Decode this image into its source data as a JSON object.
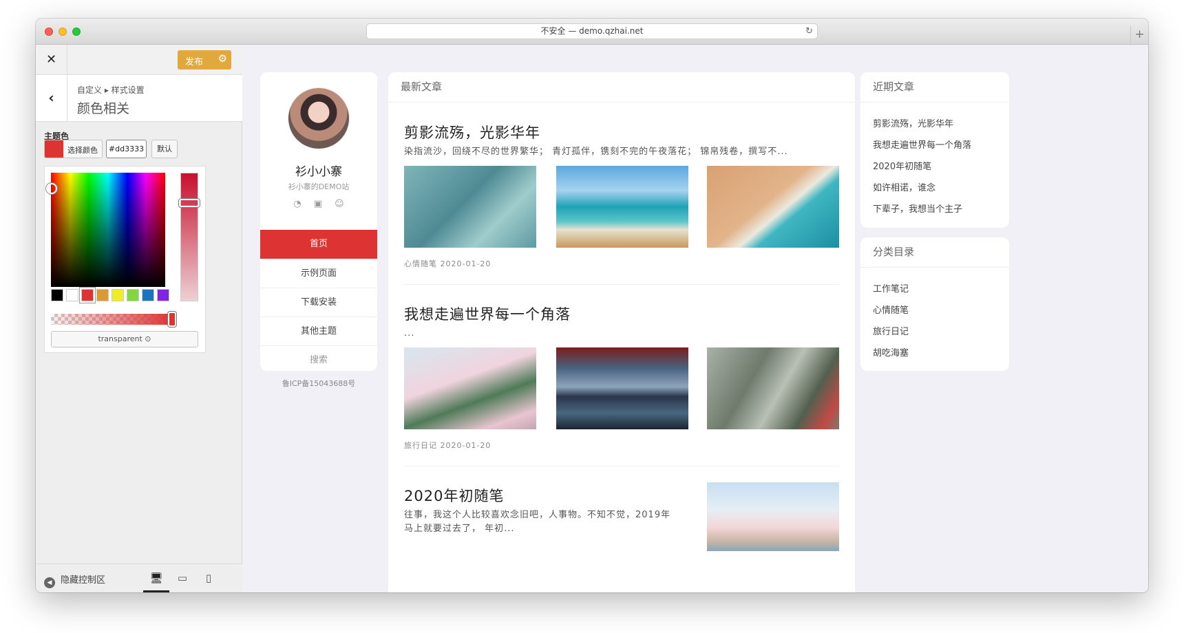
{
  "browser": {
    "address": "不安全 — demo.qzhai.net",
    "reload_icon": "reload-icon",
    "newtab_glyph": "+"
  },
  "customizer": {
    "close_glyph": "✕",
    "publish_label": "发布",
    "publish_gear": "⚙",
    "back_glyph": "‹",
    "breadcrumb": "自定义 ▸ 样式设置",
    "section_title": "颜色相关",
    "field_label": "主题色",
    "select_color_label": "选择颜色",
    "hex_value": "#dd3333",
    "default_label": "默认",
    "transparent_label": "transparent ⊙",
    "accent": "#dd3333",
    "palette": [
      "#000000",
      "#ffffff",
      "#dd3333",
      "#dd9933",
      "#eeee22",
      "#81d742",
      "#1e73be",
      "#8224e3"
    ],
    "alpha_percent": 100,
    "hide_controls_label": "隐藏控制区",
    "devices": [
      "desktop",
      "tablet",
      "mobile"
    ]
  },
  "site": {
    "name": "衫小小寨",
    "subtitle": "衫小寨的DEMO站",
    "social_icons": [
      "weibo-icon",
      "bilibili-icon",
      "smile-icon"
    ],
    "menu": [
      "首页",
      "示例页面",
      "下载安装",
      "其他主题",
      "搜索"
    ],
    "active_menu": 0,
    "icp": "鲁ICP备15043688号",
    "main_heading": "最新文章",
    "posts": [
      {
        "title": "剪影流殇，光影华年",
        "excerpt": "染指流沙，回绕不尽的世界繁华； 青灯孤伴，镌刻不完的午夜落花； 锦帛残卷，撰写不...",
        "meta": "心情随笔 2020-01-20"
      },
      {
        "title": "我想走遍世界每一个角落",
        "excerpt": "...",
        "meta": "旅行日记 2020-01-20"
      },
      {
        "title": "2020年初随笔",
        "excerpt_line1": "往事，我这个人比较喜欢念旧吧，人事物。不知不觉，2019年",
        "excerpt_line2": "马上就要过去了， 年初..."
      }
    ],
    "recent_heading": "近期文章",
    "recent": [
      "剪影流殇，光影华年",
      "我想走遍世界每一个角落",
      "2020年初随笔",
      "如许相诺，谁念",
      "下辈子，我想当个主子"
    ],
    "category_heading": "分类目录",
    "categories": [
      "工作笔记",
      "心情随笔",
      "旅行日记",
      "胡吃海塞"
    ]
  }
}
